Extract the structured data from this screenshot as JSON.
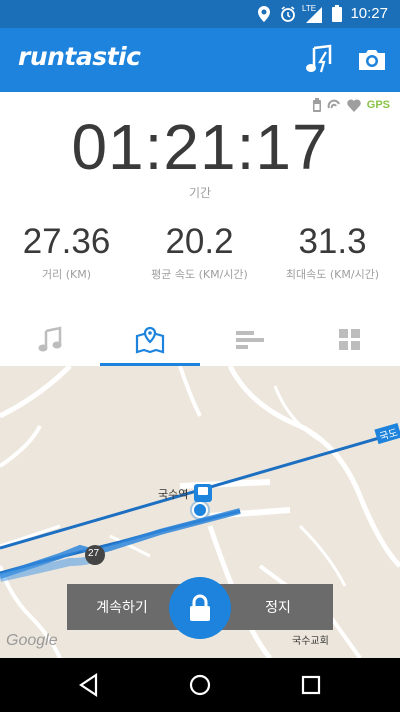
{
  "status_bar": {
    "time": "10:27",
    "network": "LTE"
  },
  "app": {
    "logo": "runtastic"
  },
  "toolbar": {
    "music_icon": "music-power-song-icon",
    "camera_icon": "camera-icon"
  },
  "indicators": {
    "gps": "GPS"
  },
  "session": {
    "duration": "01:21:17",
    "duration_label": "기간",
    "metrics": [
      {
        "value": "27.36",
        "label": "거리 (KM)"
      },
      {
        "value": "20.2",
        "label": "평균 속도 (KM/시간)"
      },
      {
        "value": "31.3",
        "label": "최대속도 (KM/시간)"
      }
    ]
  },
  "tabs": [
    {
      "name": "music",
      "icon": "music-note-icon",
      "active": false
    },
    {
      "name": "map",
      "icon": "map-icon",
      "active": true
    },
    {
      "name": "stats",
      "icon": "bars-icon",
      "active": false
    },
    {
      "name": "dashboard",
      "icon": "grid-icon",
      "active": false
    }
  ],
  "map": {
    "station_label": "국수역",
    "church_label": "국수교회",
    "road_label": "국도",
    "route_badge": "27",
    "attribution": "Google"
  },
  "controls": {
    "resume": "계속하기",
    "stop": "정지"
  },
  "colors": {
    "primary": "#1d83dc",
    "statusbar": "#1a6fb8",
    "gps": "#8bc34a",
    "route": "#1d6fc2"
  }
}
